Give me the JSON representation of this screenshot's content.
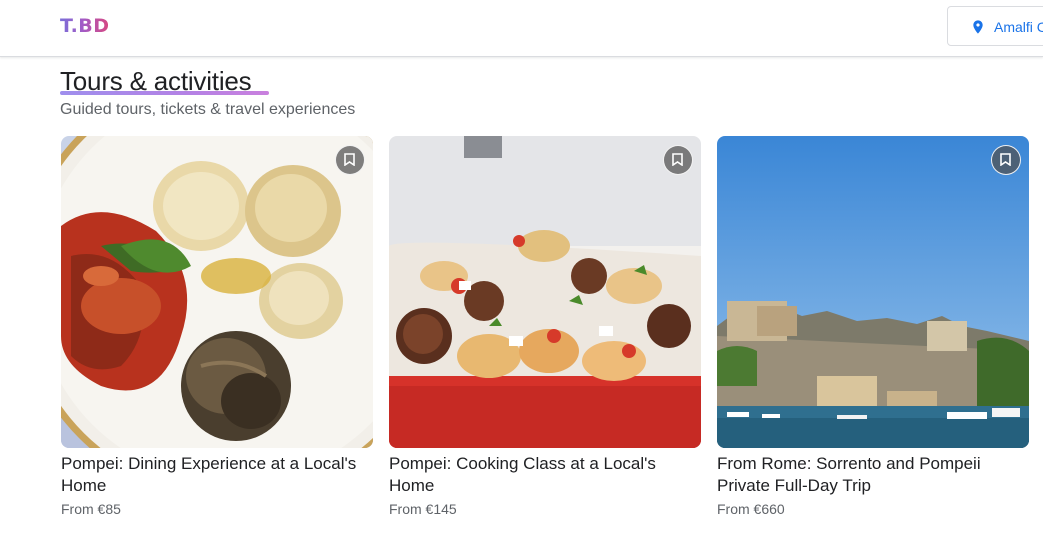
{
  "header": {
    "logo": "T.BD",
    "location": "Amalfi Coast",
    "accent": "#1a73e8"
  },
  "section": {
    "title": "Tours & activities",
    "subtitle": "Guided tours, tickets & travel experiences"
  },
  "cards": [
    {
      "title": "Pompei: Dining Experience at a Local's Home",
      "price": "From €85",
      "image": "plate-of-italian-food-photo",
      "bookmark_icon": "bookmark-icon"
    },
    {
      "title": "Pompei: Cooking Class at a Local's Home",
      "price": "From €145",
      "image": "tray-of-appetizers-photo",
      "bookmark_icon": "bookmark-icon"
    },
    {
      "title": "From Rome: Sorrento and Pompeii Private Full-Day Trip",
      "price": "From €660",
      "image": "sorrento-coastline-photo",
      "bookmark_icon": "bookmark-icon"
    }
  ]
}
